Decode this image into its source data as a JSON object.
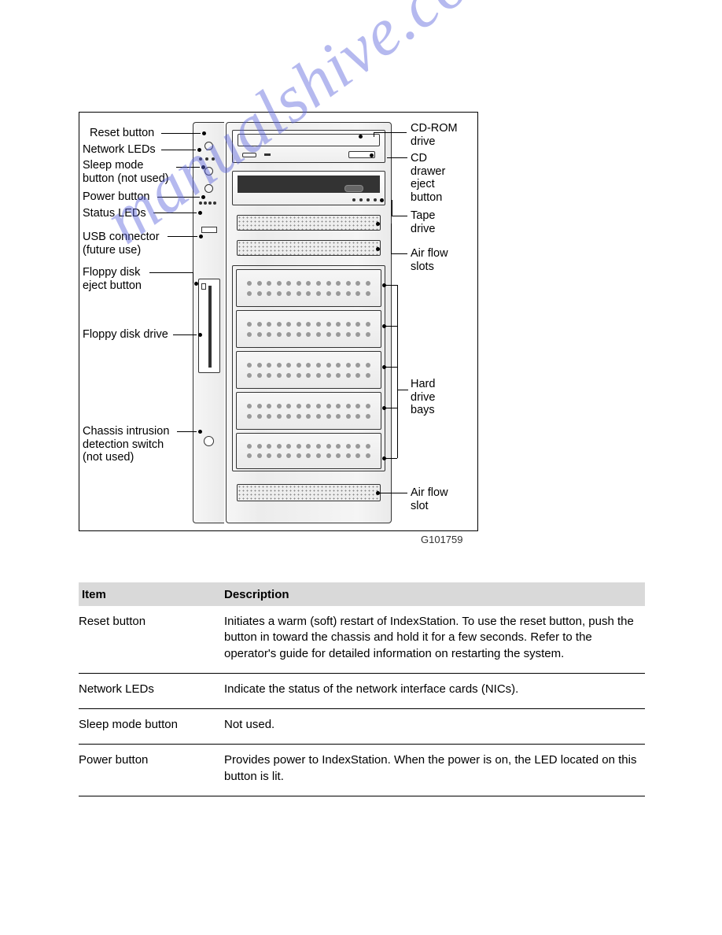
{
  "figure_id": "G101759",
  "labels_left": {
    "reset": "Reset button",
    "network": "Network LEDs",
    "sleep": "Sleep mode\nbutton (not used)",
    "power": "Power button",
    "status": "Status LEDs",
    "usb": "USB connector\n(future use)",
    "floppy_eject": "Floppy disk\neject button",
    "floppy": "Floppy disk drive",
    "intrusion": "Chassis intrusion\ndetection switch\n(not used)"
  },
  "labels_right": {
    "cdrom": "CD-ROM\ndrive",
    "cdeject": "CD\ndrawer\neject\nbutton",
    "tape": "Tape\ndrive",
    "airflow_slots": "Air flow\nslots",
    "hdd": "Hard\ndrive\nbays",
    "airflow_slot": "Air flow\nslot"
  },
  "watermark": "manualshive.com",
  "table": {
    "headers": {
      "item": "Item",
      "desc": "Description"
    },
    "rows": [
      {
        "item": "Reset button",
        "desc": "Initiates a warm (soft) restart of IndexStation. To use the reset button, push the button in toward the chassis and hold it for a few seconds. Refer to the operator's guide for detailed information on restarting the system."
      },
      {
        "item": "Network LEDs",
        "desc": "Indicate the status of the network interface cards (NICs)."
      },
      {
        "item": "Sleep mode button",
        "desc": "Not used."
      },
      {
        "item": "Power button",
        "desc": "Provides power to IndexStation. When the power is on, the LED located on this button is lit."
      }
    ]
  }
}
